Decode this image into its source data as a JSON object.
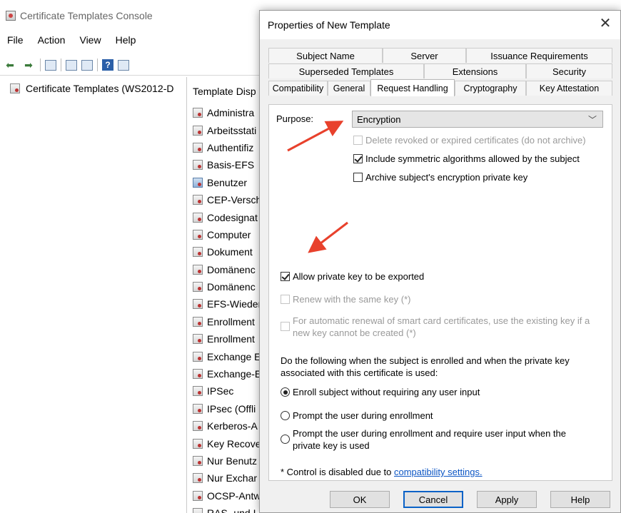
{
  "console": {
    "title": "Certificate Templates Console",
    "menu": [
      "File",
      "Action",
      "View",
      "Help"
    ],
    "tree_root": "Certificate Templates (WS2012-D",
    "list_header": "Template Disp",
    "templates": [
      "Administra",
      "Arbeitsstati",
      "Authentifiz",
      "Basis-EFS",
      "Benutzer",
      "CEP-Versch",
      "Codesignat",
      "Computer",
      "Dokument",
      "Domänenc",
      "Domänenc",
      "EFS-Wieder",
      "Enrollment",
      "Enrollment",
      "Exchange E",
      "Exchange-E",
      "IPSec",
      "IPsec (Offli",
      "Kerberos-A",
      "Key Recove",
      "Nur Benutz",
      "Nur Exchar",
      "OCSP-Antw",
      "RAS- und I"
    ]
  },
  "dialog": {
    "title": "Properties of New Template",
    "close_glyph": "✕",
    "tabs_row1": [
      "Subject Name",
      "Server",
      "Issuance Requirements"
    ],
    "tabs_row2": [
      "Superseded Templates",
      "Extensions",
      "Security"
    ],
    "tabs_row3": [
      "Compatibility",
      "General",
      "Request Handling",
      "Cryptography",
      "Key Attestation"
    ],
    "active_tab": "Request Handling",
    "purpose_label": "Purpose:",
    "purpose_value": "Encryption",
    "cb_delete_revoked": "Delete revoked or expired certificates (do not archive)",
    "cb_include_symmetric": "Include symmetric algorithms allowed by the subject",
    "cb_archive_key": "Archive subject's encryption private key",
    "cb_allow_export": "Allow private key to be exported",
    "cb_renew_same_key": "Renew with the same key (*)",
    "cb_smart_card_line1": "For automatic renewal of smart card certificates, use the existing key if a",
    "cb_smart_card_line2": "new key cannot be created (*)",
    "enroll_desc_line1": "Do the following when the subject is enrolled and when the private key",
    "enroll_desc_line2": "associated with this certificate is used:",
    "radio_enroll_no_input": "Enroll subject without requiring any user input",
    "radio_prompt_enrollment": "Prompt the user during enrollment",
    "radio_prompt_require_line1": "Prompt the user during enrollment and require user input when the",
    "radio_prompt_require_line2": "private key is used",
    "footnote_prefix": "* Control is disabled due to",
    "footnote_link": "compatibility settings.",
    "buttons": {
      "ok": "OK",
      "cancel": "Cancel",
      "apply": "Apply",
      "help": "Help"
    }
  },
  "colors": {
    "arrow": "#e8412c",
    "accent": "#0a62c7",
    "link": "#0b55c4"
  }
}
